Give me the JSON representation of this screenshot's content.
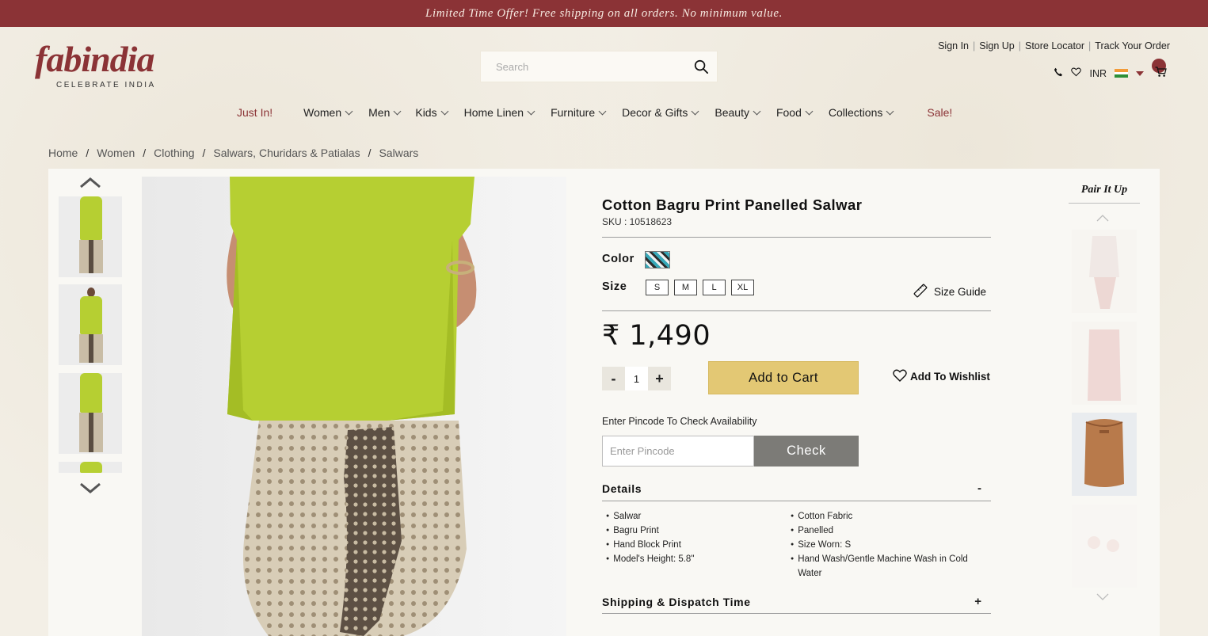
{
  "promo": {
    "text": "Limited Time Offer! Free shipping on all orders. No minimum value."
  },
  "brand": {
    "name": "fabindia",
    "tagline": "CELEBRATE INDIA",
    "color": "#8b3336"
  },
  "search": {
    "placeholder": "Search",
    "icon": "search-icon"
  },
  "top_links": [
    "Sign In",
    "Sign Up",
    "Store Locator",
    "Track Your Order"
  ],
  "utility": {
    "currency": "INR",
    "icons": [
      "phone-icon",
      "heart-icon",
      "india-flag-icon",
      "chevron-down-icon",
      "cart-icon"
    ]
  },
  "nav": [
    {
      "label": "Just In!",
      "dropdown": false,
      "highlight": true
    },
    {
      "label": "Women",
      "dropdown": true
    },
    {
      "label": "Men",
      "dropdown": true
    },
    {
      "label": "Kids",
      "dropdown": true
    },
    {
      "label": "Home Linen",
      "dropdown": true
    },
    {
      "label": "Furniture",
      "dropdown": true
    },
    {
      "label": "Decor & Gifts",
      "dropdown": true
    },
    {
      "label": "Beauty",
      "dropdown": true
    },
    {
      "label": "Food",
      "dropdown": true
    },
    {
      "label": "Collections",
      "dropdown": true
    },
    {
      "label": "Sale!",
      "dropdown": false,
      "highlight": true
    }
  ],
  "breadcrumb": [
    "Home",
    "Women",
    "Clothing",
    "Salwars, Churidars & Patialas",
    "Salwars"
  ],
  "product": {
    "title": "Cotton Bagru Print Panelled Salwar",
    "sku": "SKU : 10518623",
    "color_label": "Color",
    "size_label": "Size",
    "sizes": [
      "S",
      "M",
      "L",
      "XL"
    ],
    "size_guide": "Size Guide",
    "price": "₹ 1,490",
    "qty_minus": "-",
    "qty_value": "1",
    "qty_plus": "+",
    "add_to_cart": "Add to Cart",
    "add_to_wishlist": "Add To Wishlist",
    "pincode_label": "Enter Pincode To Check Availability",
    "pincode_placeholder": "Enter Pincode",
    "check": "Check",
    "details_title": "Details",
    "details_toggle": "-",
    "details_left": [
      "Salwar",
      "Bagru Print",
      "Hand Block Print",
      "Model's Height: 5.8\""
    ],
    "details_right": [
      "Cotton Fabric",
      "Panelled",
      "Size Worn: S",
      "Hand Wash/Gentle Machine Wash in Cold Water"
    ],
    "shipping_title": "Shipping & Dispatch Time",
    "shipping_toggle": "+"
  },
  "pair_it_up": {
    "title": "Pair It Up"
  },
  "colors": {
    "accent": "#8b3336",
    "cart_button": "#e3c874",
    "check_button": "#7c7b77",
    "kurta": "#b6cf32"
  }
}
